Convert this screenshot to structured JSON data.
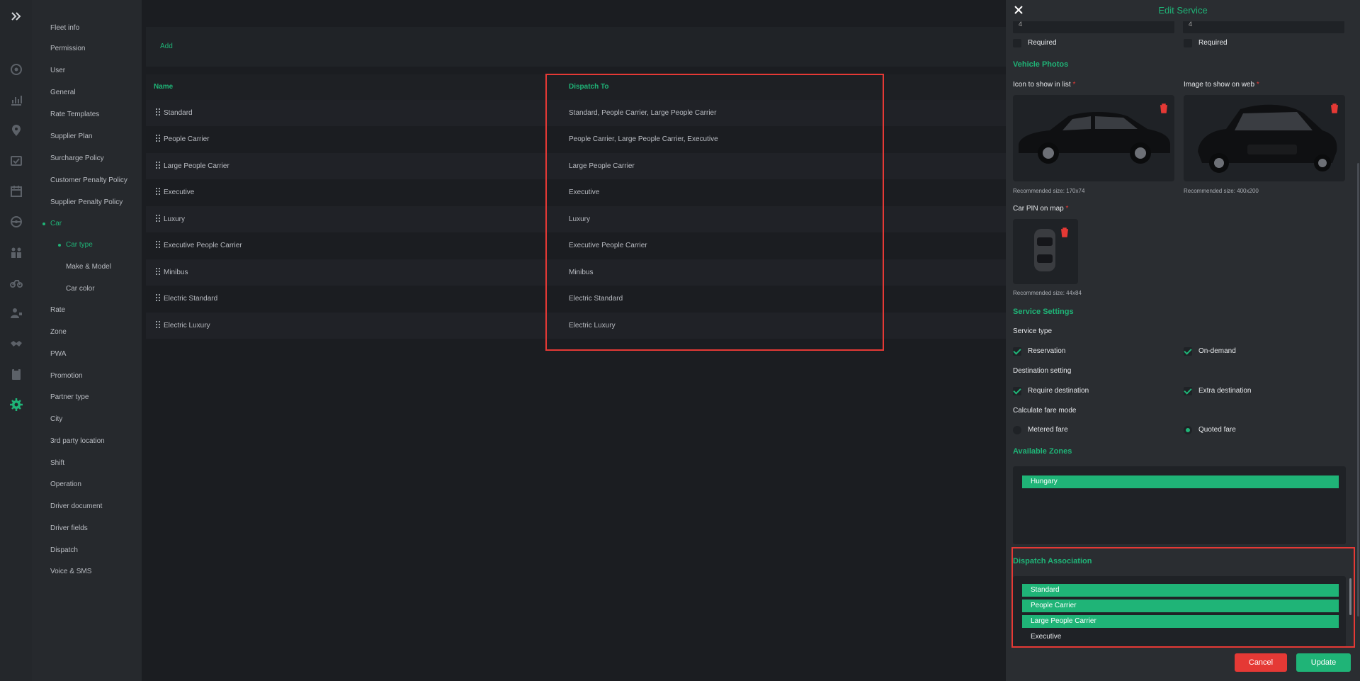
{
  "menu": {
    "items": [
      {
        "label": "Fleet info"
      },
      {
        "label": "Permission"
      },
      {
        "label": "User"
      },
      {
        "label": "General"
      },
      {
        "label": "Rate Templates"
      },
      {
        "label": "Supplier Plan"
      },
      {
        "label": "Surcharge Policy"
      },
      {
        "label": "Customer Penalty Policy"
      },
      {
        "label": "Supplier Penalty Policy"
      },
      {
        "label": "Car"
      },
      {
        "label": "Car type"
      },
      {
        "label": "Make & Model"
      },
      {
        "label": "Car color"
      },
      {
        "label": "Rate"
      },
      {
        "label": "Zone"
      },
      {
        "label": "PWA"
      },
      {
        "label": "Promotion"
      },
      {
        "label": "Partner type"
      },
      {
        "label": "City"
      },
      {
        "label": "3rd party location"
      },
      {
        "label": "Shift"
      },
      {
        "label": "Operation"
      },
      {
        "label": "Driver document"
      },
      {
        "label": "Driver fields"
      },
      {
        "label": "Dispatch"
      },
      {
        "label": "Voice & SMS"
      }
    ]
  },
  "main": {
    "add_label": "Add",
    "columns": [
      "Name",
      "Dispatch To"
    ],
    "rows": [
      {
        "name": "Standard",
        "dispatch_to": "Standard, People Carrier, Large People Carrier"
      },
      {
        "name": "People Carrier",
        "dispatch_to": "People Carrier, Large People Carrier, Executive"
      },
      {
        "name": "Large People Carrier",
        "dispatch_to": "Large People Carrier"
      },
      {
        "name": "Executive",
        "dispatch_to": "Executive"
      },
      {
        "name": "Luxury",
        "dispatch_to": "Luxury"
      },
      {
        "name": "Executive People Carrier",
        "dispatch_to": "Executive People Carrier"
      },
      {
        "name": "Minibus",
        "dispatch_to": "Minibus"
      },
      {
        "name": "Electric Standard",
        "dispatch_to": "Electric Standard"
      },
      {
        "name": "Electric Luxury",
        "dispatch_to": "Electric Luxury"
      }
    ]
  },
  "panel": {
    "title": "Edit Service",
    "top_field_left": "4",
    "top_field_right": "4",
    "required_label": "Required",
    "vehicle_photos": "Vehicle Photos",
    "icon_list_label": "Icon to show in list",
    "image_web_label": "Image to show on web",
    "required_mark": "*",
    "icon_list_note": "Recommended size: 170x74",
    "image_web_note": "Recommended size: 400x200",
    "car_pin_label": "Car PIN on map",
    "car_pin_note": "Recommended size: 44x84",
    "service_settings": "Service Settings",
    "service_type": "Service type",
    "reservation": "Reservation",
    "on_demand": "On-demand",
    "destination_setting": "Destination setting",
    "require_destination": "Require destination",
    "extra_destination": "Extra destination",
    "calc_fare_mode": "Calculate fare mode",
    "metered_fare": "Metered fare",
    "quoted_fare": "Quoted fare",
    "available_zones": "Available Zones",
    "zones": [
      "Hungary"
    ],
    "dispatch_association": "Dispatch Association",
    "dispatch_selected": [
      "Standard",
      "People Carrier",
      "Large People Carrier"
    ],
    "dispatch_unselected": [
      "Executive"
    ],
    "cancel": "Cancel",
    "update": "Update"
  },
  "colors": {
    "accent": "#1fb477",
    "danger": "#e53935",
    "panel_bg": "#2a2d31",
    "page_bg": "#1b1d21"
  }
}
